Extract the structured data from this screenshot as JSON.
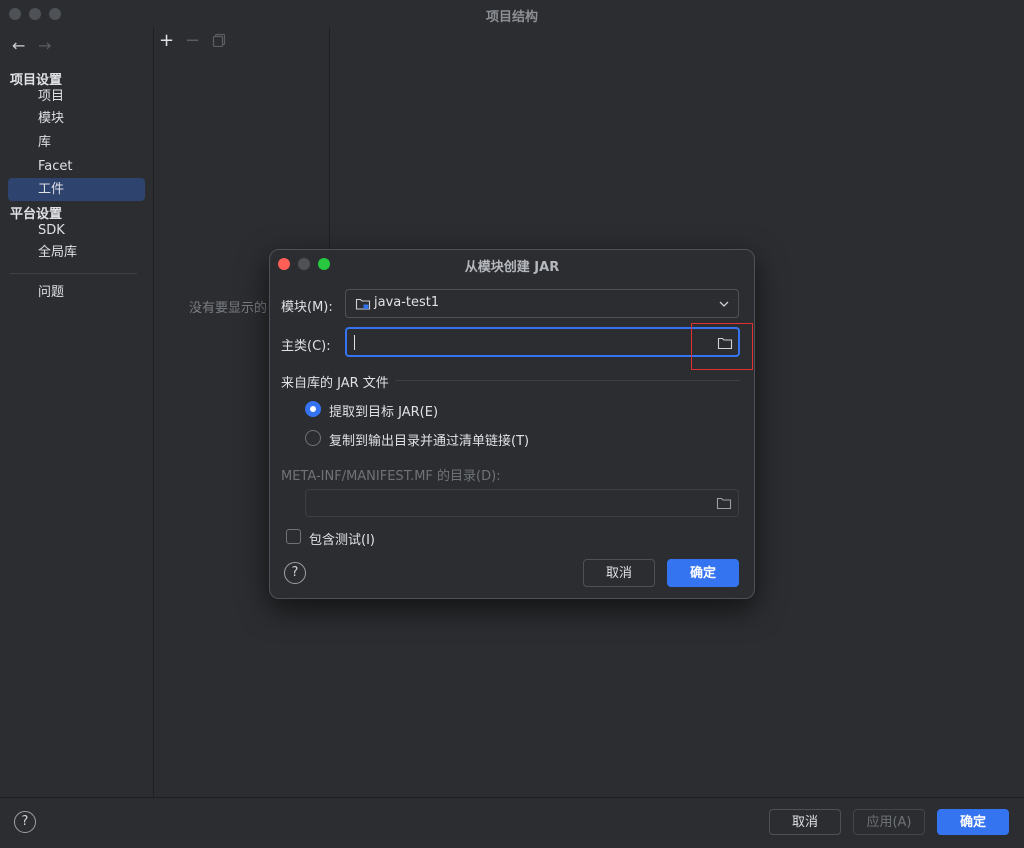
{
  "window": {
    "title": "项目结构",
    "nav_back": "←",
    "nav_forward": "→"
  },
  "sidebar": {
    "project_settings_title": "项目设置",
    "project_items": [
      "项目",
      "模块",
      "库",
      "Facet",
      "工件"
    ],
    "selected": "工件",
    "platform_settings_title": "平台设置",
    "platform_items": [
      "SDK",
      "全局库"
    ],
    "problems": "问题"
  },
  "toolbar": {
    "add": "+",
    "remove": "−"
  },
  "content": {
    "empty_message": "没有要显示的"
  },
  "footer": {
    "help": "?",
    "cancel": "取消",
    "apply": "应用(A)",
    "ok": "确定"
  },
  "dialog": {
    "title": "从模块创建 JAR",
    "module_label": "模块(M):",
    "module_value": "java-test1",
    "main_class_label": "主类(C):",
    "main_class_value": "",
    "jar_section": "来自库的 JAR 文件",
    "radio_extract": "提取到目标 JAR(E)",
    "radio_copy": "复制到输出目录并通过清单链接(T)",
    "radio_selected": "extract",
    "manifest_label": "META-INF/MANIFEST.MF 的目录(D):",
    "manifest_value": "",
    "include_tests": "包含测试(I)",
    "include_tests_checked": false,
    "help": "?",
    "cancel": "取消",
    "ok": "确定"
  },
  "colors": {
    "background": "#2b2d30",
    "accent": "#3574f0",
    "selection": "#2e436e",
    "highlight_box": "#e03131",
    "close": "#ff5f57",
    "zoom": "#28c840"
  }
}
